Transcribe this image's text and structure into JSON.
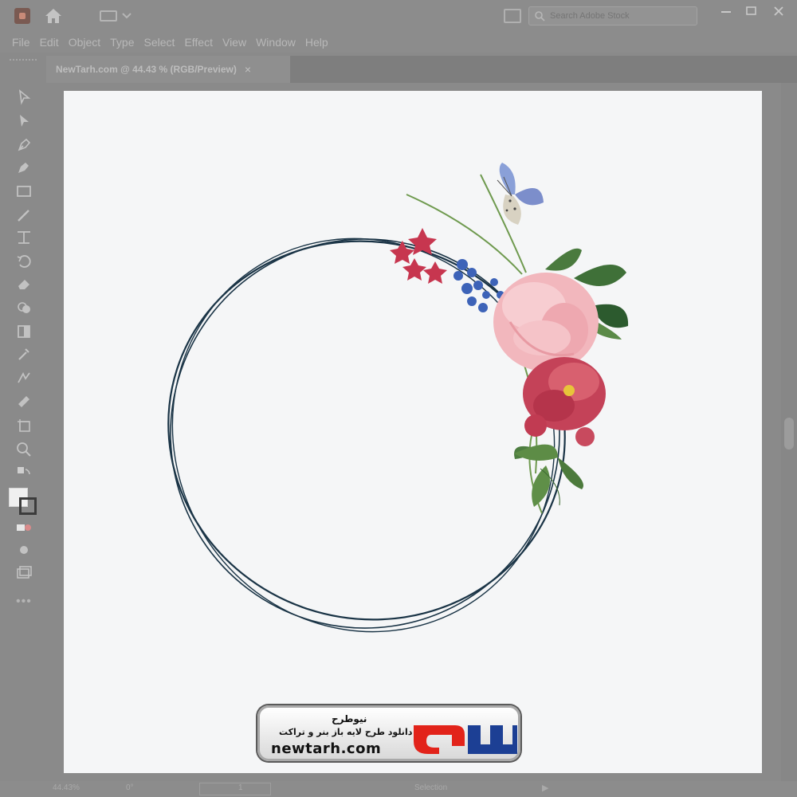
{
  "app": {
    "window_title": "",
    "search_placeholder": "Search Adobe Stock"
  },
  "menu": [
    "File",
    "Edit",
    "Object",
    "Type",
    "Select",
    "Effect",
    "View",
    "Window",
    "Help"
  ],
  "document_tab": {
    "title": "NewTarh.com @ 44.43 % (RGB/Preview)",
    "close_symbol": "×"
  },
  "toolbar": {
    "tools": [
      "selection-tool",
      "direct-selection-tool",
      "pen-tool",
      "curvature-tool",
      "rectangle-tool",
      "paintbrush-tool",
      "pencil-tool",
      "rotate-tool",
      "eraser-tool",
      "shape-builder-tool",
      "gradient-tool",
      "eyedropper-tool",
      "blend-tool",
      "symbol-sprayer-tool",
      "artboard-tool",
      "zoom-tool"
    ],
    "more_symbol": "•••"
  },
  "status": {
    "zoom": "44.43%",
    "rotation": "0°",
    "artboard": "1",
    "mode": "Selection",
    "play_symbol": "▶"
  },
  "watermark": {
    "brand_fa": "نیوطرح",
    "title_fa": "نیوطرح",
    "subtitle_fa": "دانلود طرح لایه باز بنر و تراکت",
    "url": "newtarh.com"
  },
  "colors": {
    "ring": "#1a3446",
    "brand_red": "#e2231a",
    "brand_blue": "#1c3f94",
    "artboard": "#f5f6f7"
  },
  "icons": [
    "app-logo-icon",
    "home-icon",
    "workspace-icon",
    "arrange-documents-icon",
    "search-icon",
    "minimize-icon",
    "maximize-icon",
    "close-icon",
    "butterfly-icon"
  ]
}
